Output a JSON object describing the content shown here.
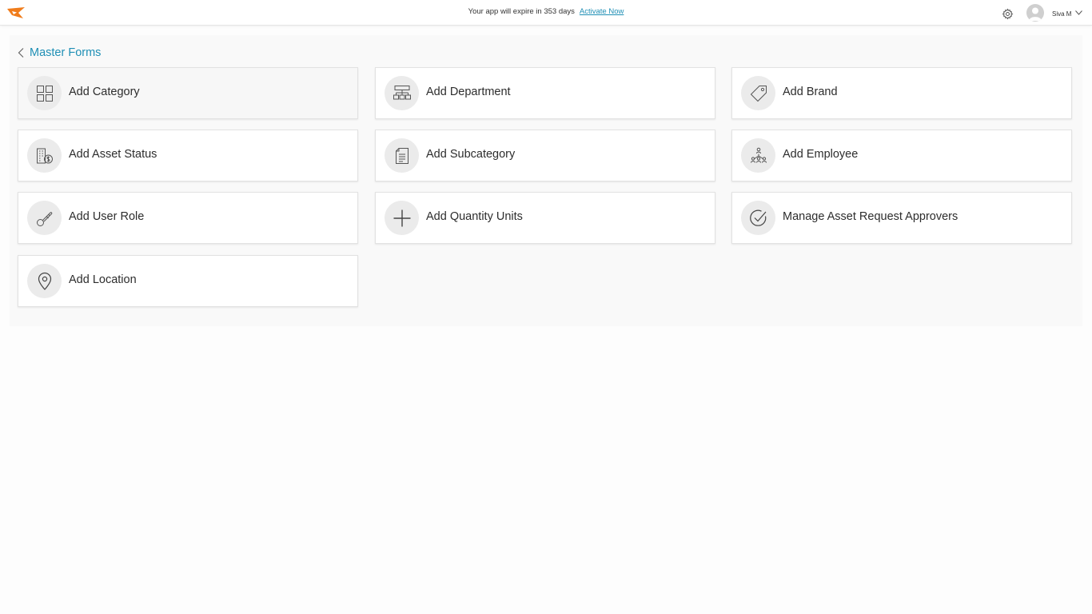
{
  "header": {
    "expiry_text": "Your app will expire in 353 days",
    "activate_label": "Activate Now",
    "user_name": "Siva M"
  },
  "page": {
    "title": "Master Forms"
  },
  "cards": [
    {
      "label": "Add Category",
      "icon": "grid-icon"
    },
    {
      "label": "Add Department",
      "icon": "org-chart-icon"
    },
    {
      "label": "Add Brand",
      "icon": "tag-icon"
    },
    {
      "label": "Add Asset Status",
      "icon": "building-dollar-icon"
    },
    {
      "label": "Add Subcategory",
      "icon": "document-icon"
    },
    {
      "label": "Add Employee",
      "icon": "people-network-icon"
    },
    {
      "label": "Add User Role",
      "icon": "key-icon"
    },
    {
      "label": "Add Quantity Units",
      "icon": "plus-icon"
    },
    {
      "label": "Manage Asset Request Approvers",
      "icon": "check-circle-icon"
    },
    {
      "label": "Add Location",
      "icon": "map-pin-icon"
    }
  ],
  "colors": {
    "accent": "#1f8fb5",
    "logo": "#f07c1b",
    "icon_bg": "#ebebeb"
  }
}
